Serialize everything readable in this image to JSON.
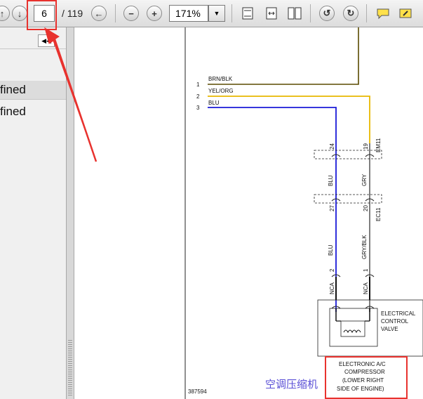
{
  "toolbar": {
    "page_current": "6",
    "page_total": "/ 119",
    "zoom_value": "171%"
  },
  "sidebar": {
    "items": [
      "fined",
      "fined"
    ]
  },
  "diagram": {
    "wire_numbers": [
      "1",
      "2",
      "3"
    ],
    "wire_labels": [
      "BRN/BLK",
      "YEL/ORG",
      "BLU"
    ],
    "connector_top": "EM11",
    "connector_mid": "EC11",
    "pin_24": "24",
    "pin_19": "19",
    "pin_27": "27",
    "pin_20": "20",
    "pin_2": "2",
    "pin_1": "1",
    "wire_blu_1": "BLU",
    "wire_gry": "GRY",
    "wire_blu_2": "BLU",
    "wire_gryblk": "GRY/BLK",
    "nca_left": "NCA",
    "nca_right": "NCA",
    "valve_label": [
      "ELECTRICAL",
      "CONTROL",
      "VALVE"
    ],
    "compressor_label": [
      "ELECTRONIC A/C",
      "COMPRESSOR",
      "(LOWER RIGHT",
      "SIDE OF ENGINE)"
    ],
    "figure_id": "387594",
    "annotation_cn": "空调压缩机"
  },
  "colors": {
    "annotation_red": "#e8322e",
    "wire_blue": "#1a1ad8",
    "wire_yellow": "#e8b800",
    "wire_brown": "#5a4a00",
    "wire_gray": "#707070"
  }
}
